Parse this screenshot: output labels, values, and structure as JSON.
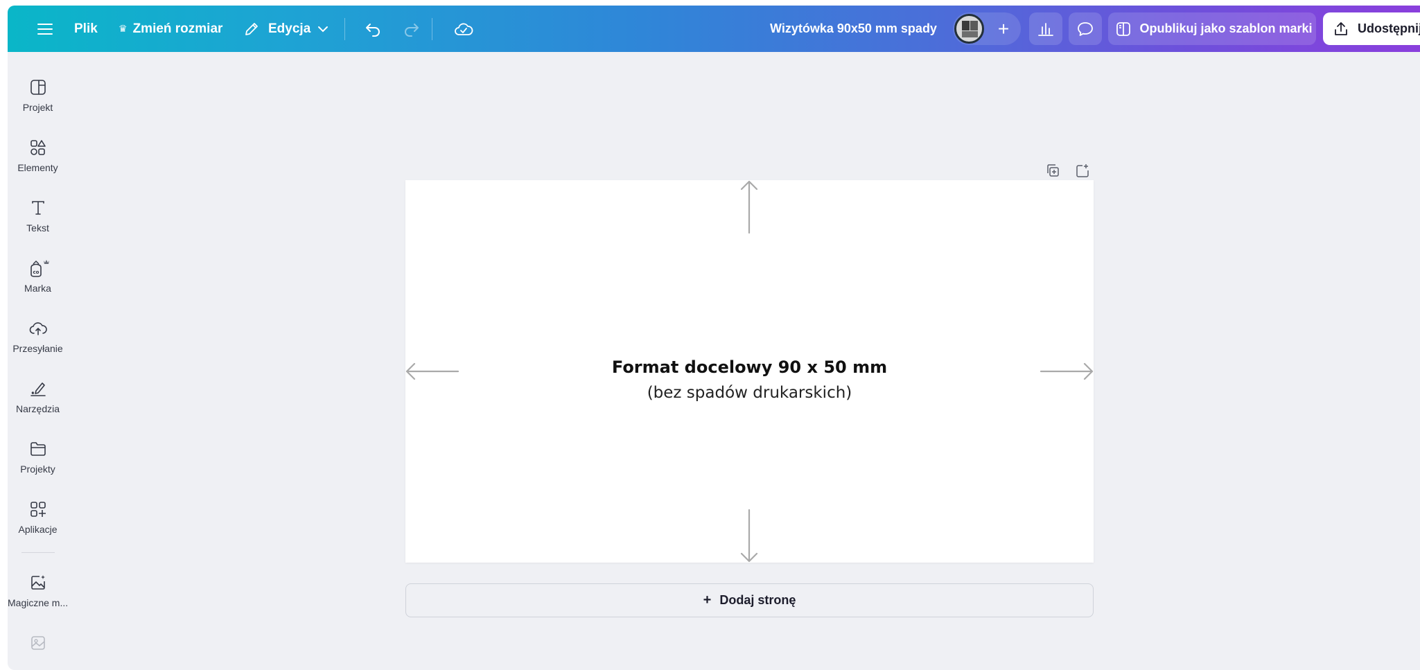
{
  "topbar": {
    "file_label": "Plik",
    "resize_label": "Zmień rozmiar",
    "edit_label": "Edycja",
    "doc_title": "Wizytówka 90x50 mm spady",
    "publish_label": "Opublikuj jako szablon marki",
    "share_label": "Udostępnij",
    "collab_add": "+",
    "crown": "♛"
  },
  "sidebar": {
    "items": [
      {
        "label": "Projekt",
        "icon": "layout-icon"
      },
      {
        "label": "Elementy",
        "icon": "shapes-icon"
      },
      {
        "label": "Tekst",
        "icon": "text-icon"
      },
      {
        "label": "Marka",
        "icon": "brand-icon"
      },
      {
        "label": "Przesyłanie",
        "icon": "upload-cloud-icon"
      },
      {
        "label": "Narzędzia",
        "icon": "draw-tool-icon"
      },
      {
        "label": "Projekty",
        "icon": "folder-icon"
      },
      {
        "label": "Aplikacje",
        "icon": "apps-icon"
      },
      {
        "label": "Magiczne m...",
        "icon": "magic-media-icon"
      }
    ]
  },
  "canvas": {
    "title": "Format docelowy 90 x 50 mm",
    "subtitle": "(bez spadów drukarskich)",
    "add_page_label": "Dodaj stronę",
    "add_page_plus": "+"
  },
  "colors": {
    "gradient_start": "#0ab6c8",
    "gradient_end": "#8a3fdc",
    "workspace_bg": "#eff0f4"
  }
}
